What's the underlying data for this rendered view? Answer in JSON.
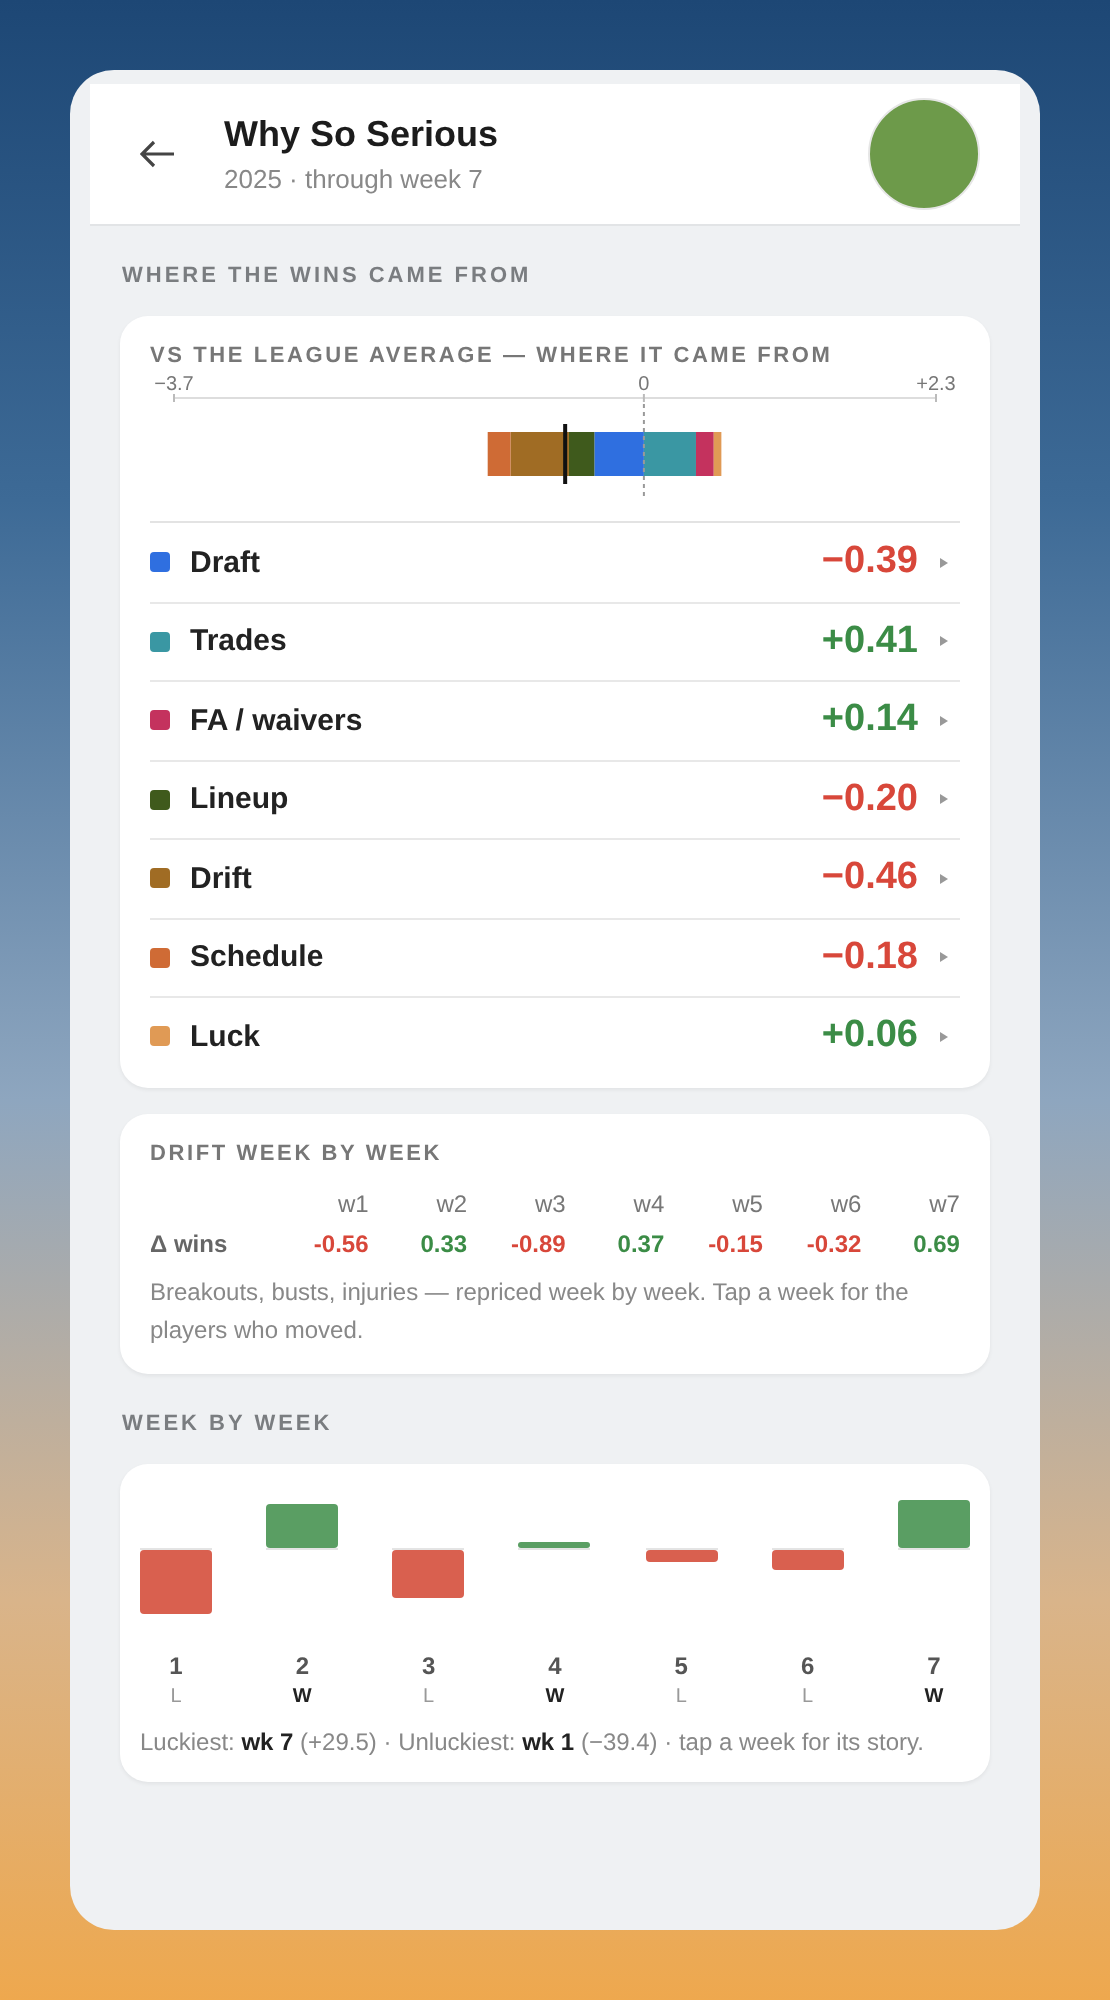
{
  "header": {
    "title": "Why So Serious",
    "subtitle": "2025 · through week 7"
  },
  "section_title": "WHERE THE WINS CAME FROM",
  "breakdown": {
    "title": "VS THE LEAGUE AVERAGE — WHERE IT CAME FROM",
    "chart_data": {
      "type": "bar",
      "orientation": "horizontal",
      "stacked": true,
      "xlim": [
        -3.7,
        2.3
      ],
      "value_labels": [
        "−0.39",
        "+0.41",
        "+0.14",
        "−0.20",
        "−0.46",
        "−0.18",
        "+0.06"
      ],
      "xticks": [
        {
          "value": -3.7,
          "label": "−3.7"
        },
        {
          "value": 0,
          "label": "0"
        },
        {
          "value": 2.3,
          "label": "+2.3"
        }
      ],
      "series": [
        {
          "name": "Draft",
          "color": "#2f6fe0",
          "values": [
            -0.39
          ]
        },
        {
          "name": "Trades",
          "color": "#3a97a3",
          "values": [
            0.41
          ]
        },
        {
          "name": "FA / waivers",
          "color": "#c4325e",
          "values": [
            0.14
          ]
        },
        {
          "name": "Lineup",
          "color": "#3f5a1c",
          "values": [
            -0.2
          ]
        },
        {
          "name": "Drift",
          "color": "#a06c24",
          "values": [
            -0.46
          ]
        },
        {
          "name": "Schedule",
          "color": "#cf6b35",
          "values": [
            -0.18
          ]
        },
        {
          "name": "Luck",
          "color": "#e09a55",
          "values": [
            0.06
          ]
        }
      ]
    }
  },
  "drift": {
    "title": "DRIFT WEEK BY WEEK",
    "row_label": "Δ wins",
    "weeks": [
      {
        "label": "w1",
        "value": "-0.56"
      },
      {
        "label": "w2",
        "value": "0.33"
      },
      {
        "label": "w3",
        "value": "-0.89"
      },
      {
        "label": "w4",
        "value": "0.37"
      },
      {
        "label": "w5",
        "value": "-0.15"
      },
      {
        "label": "w6",
        "value": "-0.32"
      },
      {
        "label": "w7",
        "value": "0.69"
      }
    ],
    "note": "Breakouts, busts, injuries — repriced week by week. Tap a week for the players who moved."
  },
  "week_section_title": "WEEK BY WEEK",
  "weeks": {
    "items": [
      {
        "week": "1",
        "result": "L"
      },
      {
        "week": "2",
        "result": "W"
      },
      {
        "week": "3",
        "result": "L"
      },
      {
        "week": "4",
        "result": "W"
      },
      {
        "week": "5",
        "result": "L"
      },
      {
        "week": "6",
        "result": "L"
      },
      {
        "week": "7",
        "result": "W"
      }
    ],
    "note": "Luckiest: **wk 7** (+29.5) · Unluckiest: **wk 1** (−39.4) · tap a week for its story."
  }
}
